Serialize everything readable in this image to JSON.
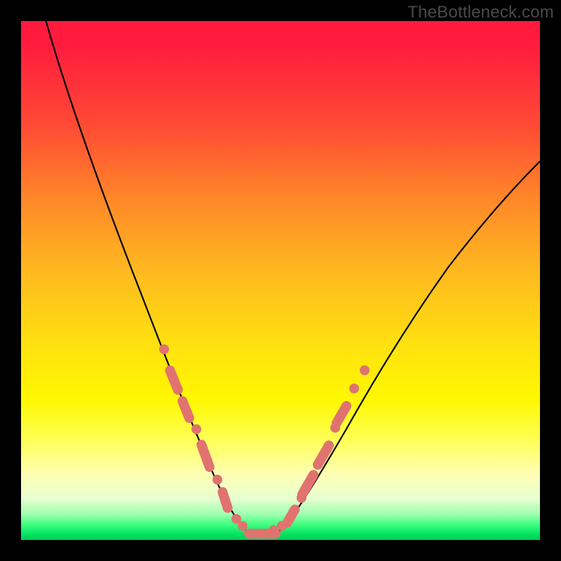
{
  "watermark": "TheBottleneck.com",
  "colors": {
    "dot": "#e0736f",
    "curve": "#000000",
    "frame": "#000000"
  },
  "chart_data": {
    "type": "line",
    "title": "",
    "xlabel": "",
    "ylabel": "",
    "xlim": [
      0,
      100
    ],
    "ylim": [
      0,
      100
    ],
    "grid": false,
    "legend": false,
    "annotations": [
      "TheBottleneck.com"
    ],
    "series": [
      {
        "name": "bottleneck-curve",
        "x": [
          0,
          3,
          6,
          9,
          12,
          15,
          18,
          21,
          24,
          27,
          30,
          32,
          34,
          36,
          38,
          40,
          42,
          44,
          46,
          48,
          50,
          53,
          56,
          60,
          65,
          70,
          76,
          82,
          88,
          94,
          100
        ],
        "y": [
          100,
          93,
          86,
          79,
          72,
          65,
          58,
          51,
          44,
          37,
          30,
          25,
          20,
          15,
          10,
          6,
          3,
          1,
          0.5,
          1,
          3,
          7,
          12,
          19,
          27,
          34,
          42,
          50,
          57,
          63,
          68
        ],
        "note": "Approximate V-shaped bottleneck / compatibility curve. Y=0 is the green floor (best match), Y=100 is top (worst / red). Minimum sits near x≈46."
      }
    ],
    "markers": {
      "note": "Salmon dots and rounded segments overlay the curve in the lower ~30% region on both arms of the V.",
      "left_arm_x_range": [
        27,
        40
      ],
      "right_arm_x_range": [
        48,
        60
      ],
      "bottom_cluster_x_range": [
        40,
        50
      ]
    }
  }
}
